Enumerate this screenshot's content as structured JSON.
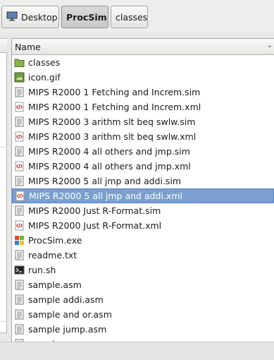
{
  "pathbar": {
    "crumbs": [
      {
        "label": "Desktop"
      },
      {
        "label": "ProcSim",
        "active": true
      },
      {
        "label": "classes"
      }
    ]
  },
  "filelist": {
    "column_name": "Name",
    "files": [
      {
        "name": "classes",
        "icon": "folder-icon"
      },
      {
        "name": "icon.gif",
        "icon": "image-icon"
      },
      {
        "name": "MIPS R2000 1 Fetching and Increm.sim",
        "icon": "text-file-icon"
      },
      {
        "name": "MIPS R2000 1 Fetching and Increm.xml",
        "icon": "xml-file-icon"
      },
      {
        "name": "MIPS R2000 3 arithm slt beq swlw.sim",
        "icon": "text-file-icon"
      },
      {
        "name": "MIPS R2000 3 arithm slt beq swlw.xml",
        "icon": "xml-file-icon"
      },
      {
        "name": "MIPS R2000 4 all others and jmp.sim",
        "icon": "text-file-icon"
      },
      {
        "name": "MIPS R2000 4 all others and jmp.xml",
        "icon": "xml-file-icon"
      },
      {
        "name": "MIPS R2000 5 all jmp and addi.sim",
        "icon": "text-file-icon"
      },
      {
        "name": "MIPS R2000 5 all jmp and addi.xml",
        "icon": "xml-file-icon",
        "selected": true
      },
      {
        "name": "MIPS R2000 Just R-Format.sim",
        "icon": "text-file-icon"
      },
      {
        "name": "MIPS R2000 Just R-Format.xml",
        "icon": "xml-file-icon"
      },
      {
        "name": "ProcSim.exe",
        "icon": "exe-icon"
      },
      {
        "name": "readme.txt",
        "icon": "text-file-icon"
      },
      {
        "name": "run.sh",
        "icon": "terminal-icon"
      },
      {
        "name": "sample.asm",
        "icon": "text-file-icon"
      },
      {
        "name": "sample addi.asm",
        "icon": "text-file-icon"
      },
      {
        "name": "sample and or.asm",
        "icon": "text-file-icon"
      },
      {
        "name": "sample jump.asm",
        "icon": "text-file-icon"
      },
      {
        "name": "sample ...",
        "icon": "text-file-icon"
      }
    ]
  },
  "colors": {
    "selection": "#7a9fd0",
    "xml_red": "#c7312a",
    "folder_green": "#7aa33d"
  }
}
